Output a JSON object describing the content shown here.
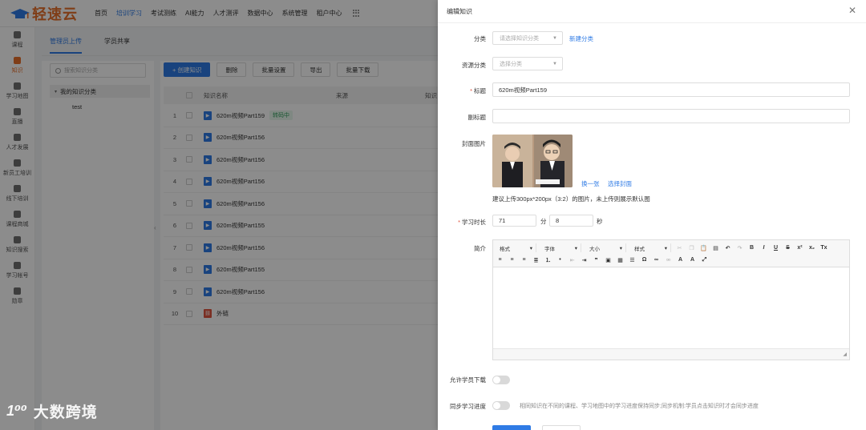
{
  "app": {
    "logo_text": "轻速云"
  },
  "topnav": {
    "items": [
      "首页",
      "培训学习",
      "考试测练",
      "AI能力",
      "人才测评",
      "数据中心",
      "系统管理",
      "租户中心"
    ],
    "active_index": 1
  },
  "rail": {
    "items": [
      "课程",
      "知识",
      "学习地图",
      "直播",
      "人才发展",
      "新员工培训",
      "线下培训",
      "课程商城",
      "知识搜索",
      "学习帐号",
      "勋章"
    ],
    "active_index": 1
  },
  "main": {
    "tabs": [
      "管理员上传",
      "学员共享"
    ],
    "search_placeholder": "搜索知识分类",
    "tree_root": "我的知识分类",
    "tree_child": "test",
    "toolbar": [
      "+ 创建知识",
      "删除",
      "批量设置",
      "导出",
      "批量下载"
    ],
    "columns": [
      "知识名称",
      "来源",
      "知识"
    ],
    "rows": [
      {
        "idx": "1",
        "name": "620m视频Part159",
        "tag": "转码中",
        "type": "video"
      },
      {
        "idx": "2",
        "name": "620m视频Part156",
        "type": "video"
      },
      {
        "idx": "3",
        "name": "620m视频Part156",
        "type": "video"
      },
      {
        "idx": "4",
        "name": "620m视频Part156",
        "type": "video"
      },
      {
        "idx": "5",
        "name": "620m视频Part156",
        "type": "video"
      },
      {
        "idx": "6",
        "name": "620m视频Part155",
        "type": "video"
      },
      {
        "idx": "7",
        "name": "620m视频Part156",
        "type": "video"
      },
      {
        "idx": "8",
        "name": "620m视频Part155",
        "type": "video"
      },
      {
        "idx": "9",
        "name": "620m视频Part156",
        "type": "video"
      },
      {
        "idx": "10",
        "name": "外链",
        "type": "link"
      }
    ]
  },
  "watermark": {
    "logo": "1⁰⁰",
    "text": "大数跨境"
  },
  "drawer": {
    "title": "编辑知识",
    "category_label": "分类",
    "category_placeholder": "请选择知识分类",
    "new_category": "新建分类",
    "resource_label": "资源分类",
    "resource_placeholder": "选择分类",
    "title_label": "标题",
    "title_value": "620m视频Part159",
    "subtitle_label": "副标题",
    "subtitle_value": "",
    "cover_label": "封面图片",
    "cover_change": "换一张",
    "cover_select": "选择封面",
    "cover_hint": "建议上传300px*200px（3:2）的图片，未上传则展示默认图",
    "duration_label": "学习时长",
    "duration_min": "71",
    "duration_min_unit": "分",
    "duration_sec": "8",
    "duration_sec_unit": "秒",
    "intro_label": "简介",
    "editor_dropdowns": [
      "格式",
      "字体",
      "大小",
      "样式"
    ],
    "allow_download_label": "允许学员下载",
    "sync_label": "同步学习进度",
    "sync_hint": "相同知识在不同的课程、学习地图中的学习进度保持同步;同步机制:学员点击知识时才会同步进度"
  },
  "colors": {
    "accent": "#2f7be5",
    "brand": "#e8702a"
  }
}
